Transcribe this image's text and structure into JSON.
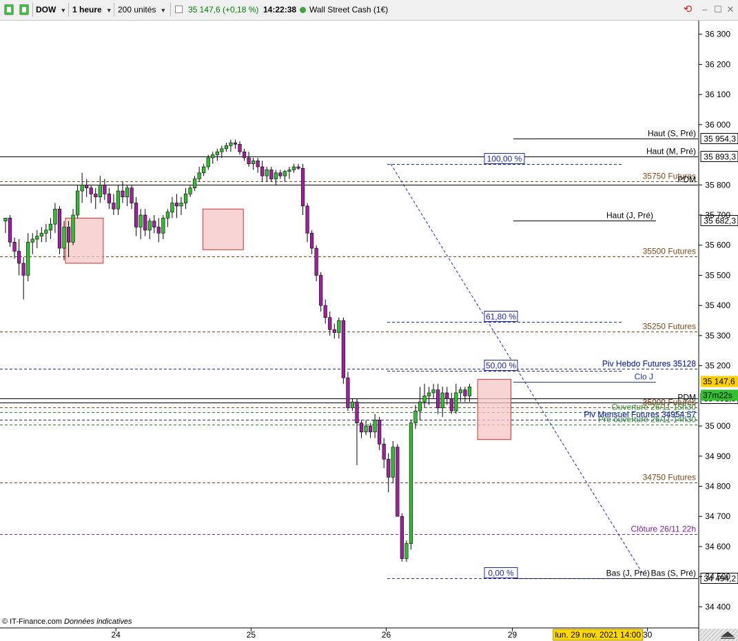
{
  "toolbar": {
    "symbol": "DOW",
    "timeframe": "1 heure",
    "units": "200 unités",
    "quote": "35 147,6 (+0,18 %)",
    "time": "14:22:38",
    "instrument": "Wall Street Cash (1€)",
    "colors": {
      "quote_up": "#008000",
      "status_dot": "#3aa83a"
    }
  },
  "footer": {
    "credit": "© IT-Finance.com",
    "note": "Données indicatives"
  },
  "chart_data": {
    "type": "candlestick",
    "title": "",
    "xlabel": "",
    "ylabel": "",
    "ylim": [
      34330,
      36345
    ],
    "yticks": [
      {
        "value": 36300,
        "label": "36 300"
      },
      {
        "value": 36200,
        "label": "36 200"
      },
      {
        "value": 36100,
        "label": "36 100"
      },
      {
        "value": 36000,
        "label": "36 000"
      },
      {
        "value": 35800,
        "label": "35 800"
      },
      {
        "value": 35700,
        "label": "35 700"
      },
      {
        "value": 35600,
        "label": "35 600"
      },
      {
        "value": 35500,
        "label": "35 500"
      },
      {
        "value": 35400,
        "label": "35 400"
      },
      {
        "value": 35300,
        "label": "35 300"
      },
      {
        "value": 35200,
        "label": "35 200"
      },
      {
        "value": 35000,
        "label": "35 000"
      },
      {
        "value": 34900,
        "label": "34 900"
      },
      {
        "value": 34800,
        "label": "34 800"
      },
      {
        "value": 34700,
        "label": "34 700"
      },
      {
        "value": 34600,
        "label": "34 600"
      },
      {
        "value": 34500,
        "label": "34 500"
      },
      {
        "value": 34400,
        "label": "34 400"
      }
    ],
    "xticks": [
      {
        "index": 24.5,
        "label": "24"
      },
      {
        "index": 54.5,
        "label": "25"
      },
      {
        "index": 84.5,
        "label": "26"
      },
      {
        "index": 112.5,
        "label": "29"
      },
      {
        "index": 142.5,
        "label": "30"
      }
    ],
    "cursor_label": "lun. 29 nov. 2021 14:00",
    "cursor_index": 131.5,
    "candles": [
      [
        35680,
        35690,
        35640,
        35690
      ],
      [
        35690,
        35700,
        35595,
        35610
      ],
      [
        35610,
        35625,
        35555,
        35580
      ],
      [
        35580,
        35620,
        35500,
        35540
      ],
      [
        35540,
        35560,
        35420,
        35500
      ],
      [
        35500,
        35640,
        35480,
        35610
      ],
      [
        35610,
        35640,
        35570,
        35620
      ],
      [
        35620,
        35650,
        35590,
        35630
      ],
      [
        35630,
        35660,
        35610,
        35640
      ],
      [
        35640,
        35670,
        35610,
        35650
      ],
      [
        35650,
        35690,
        35620,
        35670
      ],
      [
        35670,
        35740,
        35640,
        35720
      ],
      [
        35720,
        35730,
        35570,
        35590
      ],
      [
        35590,
        35680,
        35550,
        35660
      ],
      [
        35660,
        35680,
        35560,
        35610
      ],
      [
        35610,
        35720,
        35600,
        35700
      ],
      [
        35700,
        35800,
        35690,
        35780
      ],
      [
        35780,
        35840,
        35740,
        35800
      ],
      [
        35800,
        35820,
        35760,
        35790
      ],
      [
        35790,
        35800,
        35740,
        35770
      ],
      [
        35770,
        35790,
        35720,
        35760
      ],
      [
        35760,
        35830,
        35740,
        35800
      ],
      [
        35800,
        35820,
        35750,
        35770
      ],
      [
        35770,
        35790,
        35720,
        35740
      ],
      [
        35740,
        35770,
        35700,
        35720
      ],
      [
        35720,
        35800,
        35700,
        35780
      ],
      [
        35780,
        35810,
        35740,
        35760
      ],
      [
        35760,
        35800,
        35730,
        35790
      ],
      [
        35790,
        35800,
        35720,
        35740
      ],
      [
        35740,
        35760,
        35630,
        35660
      ],
      [
        35660,
        35720,
        35620,
        35700
      ],
      [
        35700,
        35720,
        35630,
        35650
      ],
      [
        35650,
        35690,
        35620,
        35680
      ],
      [
        35680,
        35700,
        35640,
        35660
      ],
      [
        35660,
        35690,
        35610,
        35640
      ],
      [
        35640,
        35700,
        35620,
        35690
      ],
      [
        35690,
        35720,
        35660,
        35710
      ],
      [
        35710,
        35760,
        35690,
        35740
      ],
      [
        35740,
        35770,
        35690,
        35730
      ],
      [
        35730,
        35760,
        35700,
        35740
      ],
      [
        35740,
        35790,
        35720,
        35770
      ],
      [
        35770,
        35800,
        35760,
        35790
      ],
      [
        35790,
        35830,
        35780,
        35820
      ],
      [
        35820,
        35860,
        35810,
        35840
      ],
      [
        35840,
        35870,
        35830,
        35860
      ],
      [
        35860,
        35900,
        35850,
        35890
      ],
      [
        35890,
        35910,
        35870,
        35900
      ],
      [
        35900,
        35920,
        35880,
        35910
      ],
      [
        35910,
        35930,
        35890,
        35920
      ],
      [
        35920,
        35940,
        35910,
        35930
      ],
      [
        35930,
        35950,
        35910,
        35940
      ],
      [
        35940,
        35950,
        35920,
        35935
      ],
      [
        35935,
        35945,
        35900,
        35910
      ],
      [
        35910,
        35920,
        35880,
        35890
      ],
      [
        35890,
        35910,
        35860,
        35870
      ],
      [
        35870,
        35890,
        35850,
        35880
      ],
      [
        35880,
        35890,
        35840,
        35860
      ],
      [
        35860,
        35880,
        35810,
        35830
      ],
      [
        35830,
        35860,
        35810,
        35850
      ],
      [
        35850,
        35860,
        35810,
        35820
      ],
      [
        35820,
        35850,
        35800,
        35840
      ],
      [
        35840,
        35850,
        35820,
        35830
      ],
      [
        35830,
        35850,
        35810,
        35845
      ],
      [
        35845,
        35860,
        35820,
        35850
      ],
      [
        35850,
        35870,
        35840,
        35860
      ],
      [
        35860,
        35870,
        35850,
        35855
      ],
      [
        35855,
        35870,
        35700,
        35730
      ],
      [
        35730,
        35740,
        35610,
        35640
      ],
      [
        35640,
        35650,
        35570,
        35590
      ],
      [
        35590,
        35600,
        35480,
        35500
      ],
      [
        35500,
        35510,
        35380,
        35400
      ],
      [
        35400,
        35420,
        35340,
        35360
      ],
      [
        35360,
        35380,
        35300,
        35320
      ],
      [
        35320,
        35340,
        35290,
        35310
      ],
      [
        35310,
        35360,
        35290,
        35350
      ],
      [
        35350,
        35360,
        35140,
        35160
      ],
      [
        35160,
        35180,
        35050,
        35060
      ],
      [
        35060,
        35090,
        35050,
        35080
      ],
      [
        35080,
        35090,
        34870,
        35010
      ],
      [
        35010,
        35020,
        34960,
        34980
      ],
      [
        34980,
        35020,
        34970,
        35000
      ],
      [
        35000,
        35010,
        34960,
        34980
      ],
      [
        34980,
        35040,
        34960,
        35020
      ],
      [
        35020,
        35030,
        34920,
        34940
      ],
      [
        34940,
        34960,
        34860,
        34890
      ],
      [
        34890,
        34910,
        34780,
        34830
      ],
      [
        34830,
        34950,
        34810,
        34930
      ],
      [
        34930,
        34940,
        34700,
        34700
      ],
      [
        34700,
        34710,
        34550,
        34560
      ],
      [
        34560,
        34620,
        34550,
        34610
      ],
      [
        34610,
        35020,
        34590,
        35010
      ],
      [
        35010,
        35070,
        34990,
        35050
      ],
      [
        35050,
        35130,
        35020,
        35080
      ],
      [
        35080,
        35140,
        35060,
        35100
      ],
      [
        35100,
        35130,
        35070,
        35110
      ],
      [
        35110,
        35140,
        35090,
        35120
      ],
      [
        35120,
        35140,
        35040,
        35060
      ],
      [
        35060,
        35130,
        35030,
        35110
      ],
      [
        35110,
        35130,
        35070,
        35090
      ],
      [
        35090,
        35110,
        35040,
        35050
      ],
      [
        35050,
        35140,
        35040,
        35110
      ],
      [
        35110,
        35130,
        35080,
        35120
      ],
      [
        35120,
        35130,
        35080,
        35100
      ],
      [
        35100,
        35140,
        35080,
        35130
      ]
    ],
    "candle_layout": {
      "x0": 8,
      "step": 6.538
    },
    "colors": {
      "up": "#2fbf2f",
      "down": "#a020a0",
      "wick": "#000000"
    },
    "zones": [
      {
        "i0": 13.3,
        "i1": 21.7,
        "top": 35690,
        "bottom": 35540
      },
      {
        "i0": 43.8,
        "i1": 52.8,
        "top": 35720,
        "bottom": 35585
      },
      {
        "i0": 104.8,
        "i1": 112.2,
        "top": 35155,
        "bottom": 34955
      }
    ],
    "levels": [
      {
        "price": 35954.3,
        "label": "Haut (S, Pré)",
        "style": "solid",
        "color": "#000000",
        "x1": 745,
        "x2": 1013,
        "label_anchor": "end",
        "label_x": 1010,
        "tag": "35 954,3"
      },
      {
        "price": 35893.3,
        "label": "Haut (M, Pré)",
        "style": "solid",
        "color": "#000000",
        "x1": 0,
        "x2": 1013,
        "label_anchor": "end",
        "label_x": 1010,
        "tag": "35 893,3"
      },
      {
        "price": 35813,
        "label": "35750 Futures",
        "style": "dashed",
        "color": "#7a4a1a",
        "x1": 0,
        "x2": 1013,
        "label_anchor": "end",
        "label_x": 1010
      },
      {
        "price": 35800,
        "label": "PDM",
        "style": "solid",
        "color": "#000000",
        "x1": 0,
        "x2": 1013,
        "label_anchor": "end",
        "label_x": 1010
      },
      {
        "price": 35682.3,
        "label": "Haut (J, Pré)",
        "style": "solid",
        "color": "#000000",
        "x1": 745,
        "x2": 952,
        "label_anchor": "end",
        "label_x": 948,
        "tag": "35 682,3"
      },
      {
        "price": 35563,
        "label": "35500 Futures",
        "style": "dashed",
        "color": "#7a4a1a",
        "x1": 0,
        "x2": 1013,
        "label_anchor": "end",
        "label_x": 1010
      },
      {
        "price": 35313,
        "label": "35250 Futures",
        "style": "dashed",
        "color": "#7a4a1a",
        "x1": 0,
        "x2": 1013,
        "label_anchor": "end",
        "label_x": 1010
      },
      {
        "price": 35190,
        "label": "Piv Hebdo Futures 35128",
        "style": "dashed",
        "color": "#1a2a9a",
        "x1": 0,
        "x2": 1013,
        "label_anchor": "end",
        "label_x": 1010
      },
      {
        "price": 35147.6,
        "label": "Clo J",
        "style": "solid",
        "color": "#1a3aaa",
        "x1": 745,
        "x2": 952,
        "label_anchor": "end",
        "label_x": 948
      },
      {
        "price": 35077,
        "label": "PDM",
        "style": "solid",
        "color": "#000000",
        "x1": 0,
        "x2": 1013,
        "label_anchor": "end",
        "label_x": 1010
      },
      {
        "price": 35091.9,
        "label": "",
        "style": "solid",
        "color": "#000000",
        "x1": 0,
        "x2": 1013,
        "tag": "35 091,9"
      },
      {
        "price": 35063,
        "label": "35000 Futures",
        "style": "dashed",
        "color": "#7a4a1a",
        "x1": 0,
        "x2": 1013,
        "label_anchor": "end",
        "label_x": 1010
      },
      {
        "price": 35045,
        "label": "Ouverture 26/11 15h30",
        "style": "dashed",
        "color": "#2a8a2a",
        "x1": 0,
        "x2": 1013,
        "label_anchor": "end",
        "label_x": 1010
      },
      {
        "price": 35020,
        "label": "Piv Mensuel Futures 34954.57",
        "style": "dashed",
        "color": "#1a2a9a",
        "x1": 0,
        "x2": 1013,
        "label_anchor": "end",
        "label_x": 1010
      },
      {
        "price": 35005,
        "label": "Pré ouverture 26/11 14h30",
        "style": "dashed",
        "color": "#2a8a2a",
        "x1": 0,
        "x2": 1013,
        "label_anchor": "end",
        "label_x": 1010
      },
      {
        "price": 34813,
        "label": "34750 Futures",
        "style": "dashed",
        "color": "#7a4a1a",
        "x1": 0,
        "x2": 1013,
        "label_anchor": "end",
        "label_x": 1010
      },
      {
        "price": 34640,
        "label": "Clôture 26/11 22h",
        "style": "dashed",
        "color": "#8020a0",
        "x1": 0,
        "x2": 1013,
        "label_anchor": "end",
        "label_x": 1010
      },
      {
        "price": 34494.2,
        "label": "Bas (J, Pré)",
        "style": "solid",
        "color": "#000000",
        "x1": 745,
        "x2": 946,
        "label_anchor": "end",
        "label_x": 943,
        "tag": "34 494,2"
      },
      {
        "price": 34494.2,
        "label": "Bas (S, Pré)",
        "style": "solid",
        "color": "#000000",
        "x1": 745,
        "x2": 1013,
        "label_anchor": "end",
        "label_x": 1010,
        "tag": "34 494,2"
      }
    ],
    "fibonacci": {
      "from": {
        "index": 85.5,
        "price": 35870
      },
      "to": {
        "index": 135.5,
        "price": 34494.2
      },
      "color": "#1a2aaa",
      "x1": 562,
      "x2": 902,
      "box_x": 703,
      "levels": [
        {
          "ratio": 1.0,
          "label": "100,00 %"
        },
        {
          "ratio": 0.618,
          "label": "61,80 %"
        },
        {
          "ratio": 0.5,
          "label": "50,00 %"
        },
        {
          "ratio": 0.0,
          "label": "0,00 %"
        }
      ]
    },
    "price_tags": [
      {
        "value": 35147.6,
        "label": "35 147,6",
        "bg": "#ffd000"
      },
      {
        "value": 35125,
        "label": "37m22s",
        "bg": "#30c030"
      }
    ],
    "overlap_labels": [
      {
        "price": 35193,
        "label": "Piv Hebdo Futures 35128",
        "color": "#1a2a9a"
      },
      {
        "price": 35065,
        "label": "35000 Futures",
        "color": "#7a4a1a"
      },
      {
        "price": 35025,
        "label": "Piv Mensuel Futures 34954.57",
        "color": "#1a2a9a"
      }
    ]
  }
}
